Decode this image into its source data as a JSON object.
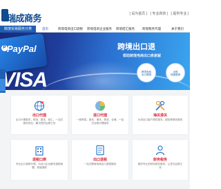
{
  "topbar": {
    "left_text": "",
    "mid_text": ""
  },
  "header": {
    "logo_text": "瑞成商务",
    "logo_sub": "",
    "top_links": [
      "[ 设为首页 ]",
      "[ 专业高效 ]",
      "[ 提供专业 ]"
    ]
  },
  "nav": {
    "all_label": "跨境贸易服务分类",
    "items": [
      "首页",
      "跨境电商出口退税",
      "跨境电商企业服务",
      "跨境结汇服务",
      "跨境税务代理",
      "关于我们"
    ]
  },
  "banner": {
    "brand_paypal": "PayPal",
    "brand_paypal_mark": "P",
    "brand_visa": "VISA",
    "title": "跨境出口退",
    "subtitle": "帮助跨境电商出口卖家解",
    "circle_left": "跨境电商\n出口退税",
    "circle_right": "合规\n快速退税"
  },
  "tiles": [
    {
      "title": "出口代理",
      "desc": "出口代理报关，物流、报关、收汇，一站式服务到位，解决您的后顾之忧",
      "icon": "globe-icon"
    },
    {
      "title": "进口代理",
      "desc": "一般贸易，报关，清关、物流、仓储，一站式全程代理服务",
      "icon": "pie-chart-icon"
    },
    {
      "title": "海关清关",
      "desc": "为进出口客户提供报关、报检等清关服务",
      "icon": "tools-icon"
    },
    {
      "title": "退税口岸",
      "desc": "专业出口退税代理，为出口企业解决退税难题，快速退税",
      "icon": "building-icon"
    },
    {
      "title": "出口退税",
      "desc": "一站式跨境电商出口退税服务",
      "icon": "document-icon"
    },
    {
      "title": "财务税务",
      "desc": "提供专业的财务税务服务，让您无后顾之忧",
      "icon": "person-icon"
    }
  ],
  "colors": {
    "brand": "#1e5fb4",
    "accent_red": "#dd2233"
  }
}
